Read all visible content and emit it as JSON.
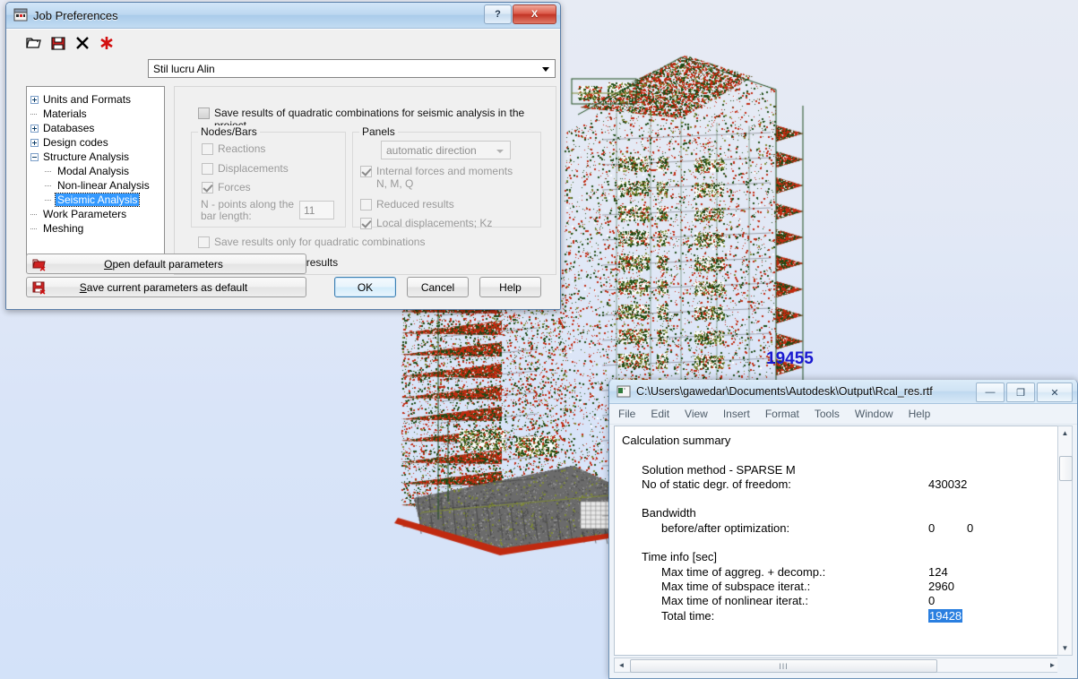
{
  "desktop": {
    "background_top_color": "#e7ebf4",
    "background_bottom_color": "#d3e2f9"
  },
  "model_view": {
    "name": "structural-fe-model-3d",
    "annotation_label": "19455",
    "annotation_color": "#1a1ad0",
    "mesh_colors": [
      "#c02a10",
      "#1d4a14",
      "#7e8a33",
      "#6b6b6b"
    ],
    "outline_color": "#1c4a1c"
  },
  "job_preferences": {
    "title": "Job Preferences",
    "titlebar_icon": "job-preferences-icon",
    "help_button": "?",
    "close_button": "X",
    "toolbar": [
      {
        "icon": "open-folder-icon",
        "name": "open-parameters"
      },
      {
        "icon": "save-floppy-icon",
        "name": "save-parameters"
      },
      {
        "icon": "delete-x-icon",
        "name": "delete-parameters"
      },
      {
        "icon": "red-asterisk-icon",
        "name": "new-parameters"
      }
    ],
    "style_combo": {
      "value": "Stil lucru Alin",
      "arrow_icon": "chevron-down-icon"
    },
    "tree": [
      {
        "label": "Units and Formats",
        "marker": "plus",
        "indent": 0,
        "selected": false
      },
      {
        "label": "Materials",
        "marker": "dash",
        "indent": 0,
        "selected": false
      },
      {
        "label": "Databases",
        "marker": "plus",
        "indent": 0,
        "selected": false
      },
      {
        "label": "Design codes",
        "marker": "plus",
        "indent": 0,
        "selected": false
      },
      {
        "label": "Structure Analysis",
        "marker": "minus",
        "indent": 0,
        "selected": false
      },
      {
        "label": "Modal Analysis",
        "marker": "dash",
        "indent": 1,
        "selected": false
      },
      {
        "label": "Non-linear Analysis",
        "marker": "dash",
        "indent": 1,
        "selected": false
      },
      {
        "label": "Seismic Analysis",
        "marker": "dash",
        "indent": 1,
        "selected": true
      },
      {
        "label": "Work Parameters",
        "marker": "dash",
        "indent": 0,
        "selected": false
      },
      {
        "label": "Meshing",
        "marker": "dash",
        "indent": 0,
        "selected": false
      }
    ],
    "settings": {
      "save_quadratic_label": "Save results of quadratic combinations for seismic analysis in the project",
      "save_quadratic_checked": false,
      "nodes_bars": {
        "legend": "Nodes/Bars",
        "items": [
          {
            "label": "Reactions",
            "checked": false,
            "disabled": true
          },
          {
            "label": "Displacements",
            "checked": false,
            "disabled": true
          },
          {
            "label": "Forces",
            "checked": true,
            "disabled": true
          }
        ],
        "npoints_label_line1": "N - points along the",
        "npoints_label_line2": "bar length:",
        "npoints_value": "11"
      },
      "panels": {
        "legend": "Panels",
        "direction_value": "automatic direction",
        "items": [
          {
            "label": "Internal forces and moments",
            "label2": "N, M, Q",
            "checked": true,
            "disabled": true
          },
          {
            "label": "Reduced results",
            "label2": "",
            "checked": false,
            "disabled": true
          },
          {
            "label": "Local displacements;  Kz",
            "label2": "",
            "checked": true,
            "disabled": true
          }
        ]
      },
      "save_only_quadratic_label": "Save results only for quadratic combinations",
      "save_only_quadratic_checked": false,
      "save_averaged_label": "Save averaged FE results",
      "save_averaged_checked": false
    },
    "footer": {
      "open_default_label": "Open default parameters",
      "open_default_accel": "O",
      "save_default_label": "Save current parameters as default",
      "save_default_accel": "S",
      "ok_label": "OK",
      "cancel_label": "Cancel",
      "help_label": "Help"
    }
  },
  "rtf_window": {
    "title": "C:\\Users\\gawedar\\Documents\\Autodesk\\Output\\Rcal_res.rtf",
    "titlebar_icon": "document-window-icon",
    "controls": {
      "minimize": "—",
      "restore": "❐",
      "close": "✕"
    },
    "menu": [
      "File",
      "Edit",
      "View",
      "Insert",
      "Format",
      "Tools",
      "Window",
      "Help"
    ],
    "document": {
      "heading": "Calculation summary",
      "lines": [
        {
          "indent": 1,
          "text": "Solution method - SPARSE M",
          "value": "",
          "value2": ""
        },
        {
          "indent": 1,
          "text": "No of static degr. of freedom:",
          "value": "430032",
          "value2": ""
        },
        {
          "indent": 0,
          "text": "",
          "value": "",
          "value2": ""
        },
        {
          "indent": 1,
          "text": "Bandwidth",
          "value": "",
          "value2": ""
        },
        {
          "indent": 2,
          "text": "before/after optimization:",
          "value": "0",
          "value2": "0"
        },
        {
          "indent": 0,
          "text": "",
          "value": "",
          "value2": ""
        },
        {
          "indent": 1,
          "text": "Time info [sec]",
          "value": "",
          "value2": ""
        },
        {
          "indent": 2,
          "text": "Max time of aggreg. + decomp.:",
          "value": "124",
          "value2": ""
        },
        {
          "indent": 2,
          "text": "Max time of subspace iterat.:",
          "value": "2960",
          "value2": ""
        },
        {
          "indent": 2,
          "text": "Max time of nonlinear iterat.:",
          "value": "0",
          "value2": ""
        },
        {
          "indent": 2,
          "text": "Total time:",
          "value": "19428",
          "value2": "",
          "value_highlighted": true
        }
      ]
    },
    "scrollbars": {
      "v_up": "▲",
      "v_down": "▼",
      "h_left": "◄",
      "h_right": "►",
      "h_grip": "III"
    }
  }
}
